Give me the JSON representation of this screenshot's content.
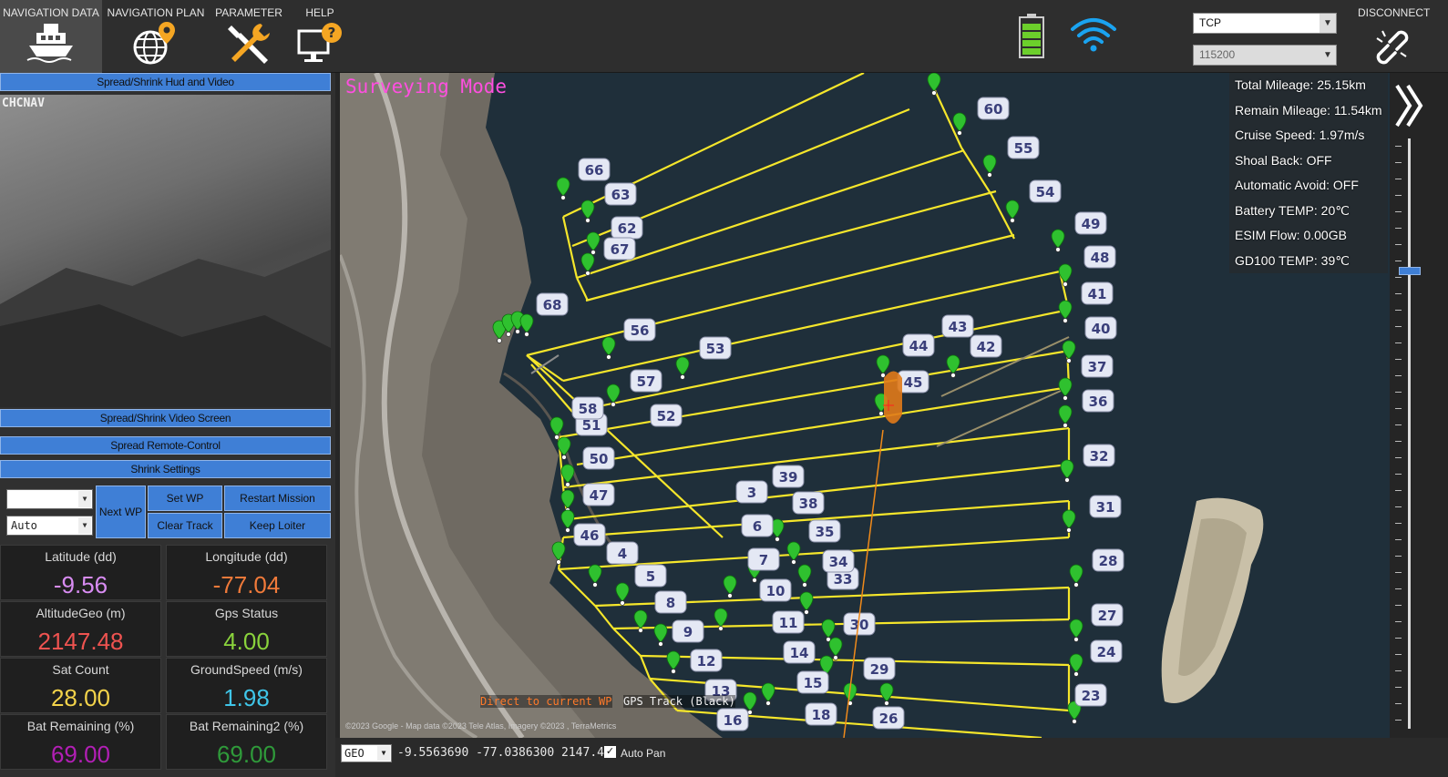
{
  "menu": {
    "items": [
      {
        "label": "NAVIGATION DATA",
        "icon": "boat-icon"
      },
      {
        "label": "NAVIGATION PLAN",
        "icon": "globe-pin-icon"
      },
      {
        "label": "PARAMETER",
        "icon": "wrench-screwdriver-icon"
      },
      {
        "label": "HELP",
        "icon": "monitor-help-icon"
      }
    ],
    "disconnect_label": "DISCONNECT"
  },
  "connection": {
    "protocol": "TCP",
    "baud": "115200"
  },
  "left_panel": {
    "hud_toggle": "Spread/Shrink Hud and Video",
    "video_osd": "CHCNAV",
    "video_toggle": "Spread/Shrink Video Screen",
    "remote_toggle": "Spread Remote-Control",
    "settings_toggle": "Shrink Settings",
    "mode_select": "",
    "mode_select2": "Auto",
    "next_wp": "Next WP",
    "set_wp": "Set WP",
    "restart_mission": "Restart Mission",
    "clear_track": "Clear Track",
    "keep_loiter": "Keep Loiter"
  },
  "quick": [
    {
      "label": "Latitude (dd)",
      "value": "-9.56",
      "color": "#d88cf2"
    },
    {
      "label": "Longitude (dd)",
      "value": "-77.04",
      "color": "#f07a3a"
    },
    {
      "label": "AltitudeGeo (m)",
      "value": "2147.48",
      "color": "#ef5350"
    },
    {
      "label": "Gps Status",
      "value": "4.00",
      "color": "#8ad33c"
    },
    {
      "label": "Sat Count",
      "value": "28.00",
      "color": "#f3d34a"
    },
    {
      "label": "GroundSpeed (m/s)",
      "value": "1.98",
      "color": "#3fc5e8"
    },
    {
      "label": "Bat Remaining (%)",
      "value": "69.00",
      "color": "#b21fb5"
    },
    {
      "label": "Bat Remaining2 (%)",
      "value": "69.00",
      "color": "#2f9a3a"
    }
  ],
  "map": {
    "mode_title": "Surveying Mode",
    "status": [
      "Total Mileage: 25.15km",
      "Remain Mileage: 11.54km",
      "Cruise Speed: 1.97m/s",
      "Shoal Back:  OFF",
      "Automatic Avoid:  OFF",
      "Battery TEMP: 20℃",
      "ESIM Flow: 0.00GB",
      "GD100 TEMP: 39℃"
    ],
    "direct_label": "Direct to current WP",
    "gps_track_label": "GPS Track (Black)",
    "copyright": "©2023 Google - Map data ©2023 Tele Atlas, Imagery ©2023 , TerraMetrics",
    "waypoint_labels": [
      "3",
      "4",
      "5",
      "6",
      "7",
      "8",
      "9",
      "10",
      "11",
      "12",
      "13",
      "14",
      "15",
      "16",
      "18",
      "23",
      "24",
      "26",
      "27",
      "28",
      "29",
      "30",
      "31",
      "32",
      "33",
      "34",
      "35",
      "36",
      "37",
      "38",
      "39",
      "40",
      "41",
      "42",
      "43",
      "44",
      "45",
      "46",
      "47",
      "48",
      "49",
      "50",
      "51",
      "52",
      "53",
      "54",
      "55",
      "56",
      "57",
      "58",
      "60",
      "62",
      "63",
      "66",
      "67",
      "68"
    ]
  },
  "bottom": {
    "coord_mode": "GEO",
    "coords": "-9.5563690  -77.0386300  2147.48",
    "autopan_label": "Auto Pan",
    "autopan_checked": true
  },
  "colors": {
    "accent_blue": "#3f7fd6",
    "route_yellow": "#f5e62b",
    "waypoint_green": "#2fc12f",
    "mode_magenta": "#ff4fe0"
  }
}
